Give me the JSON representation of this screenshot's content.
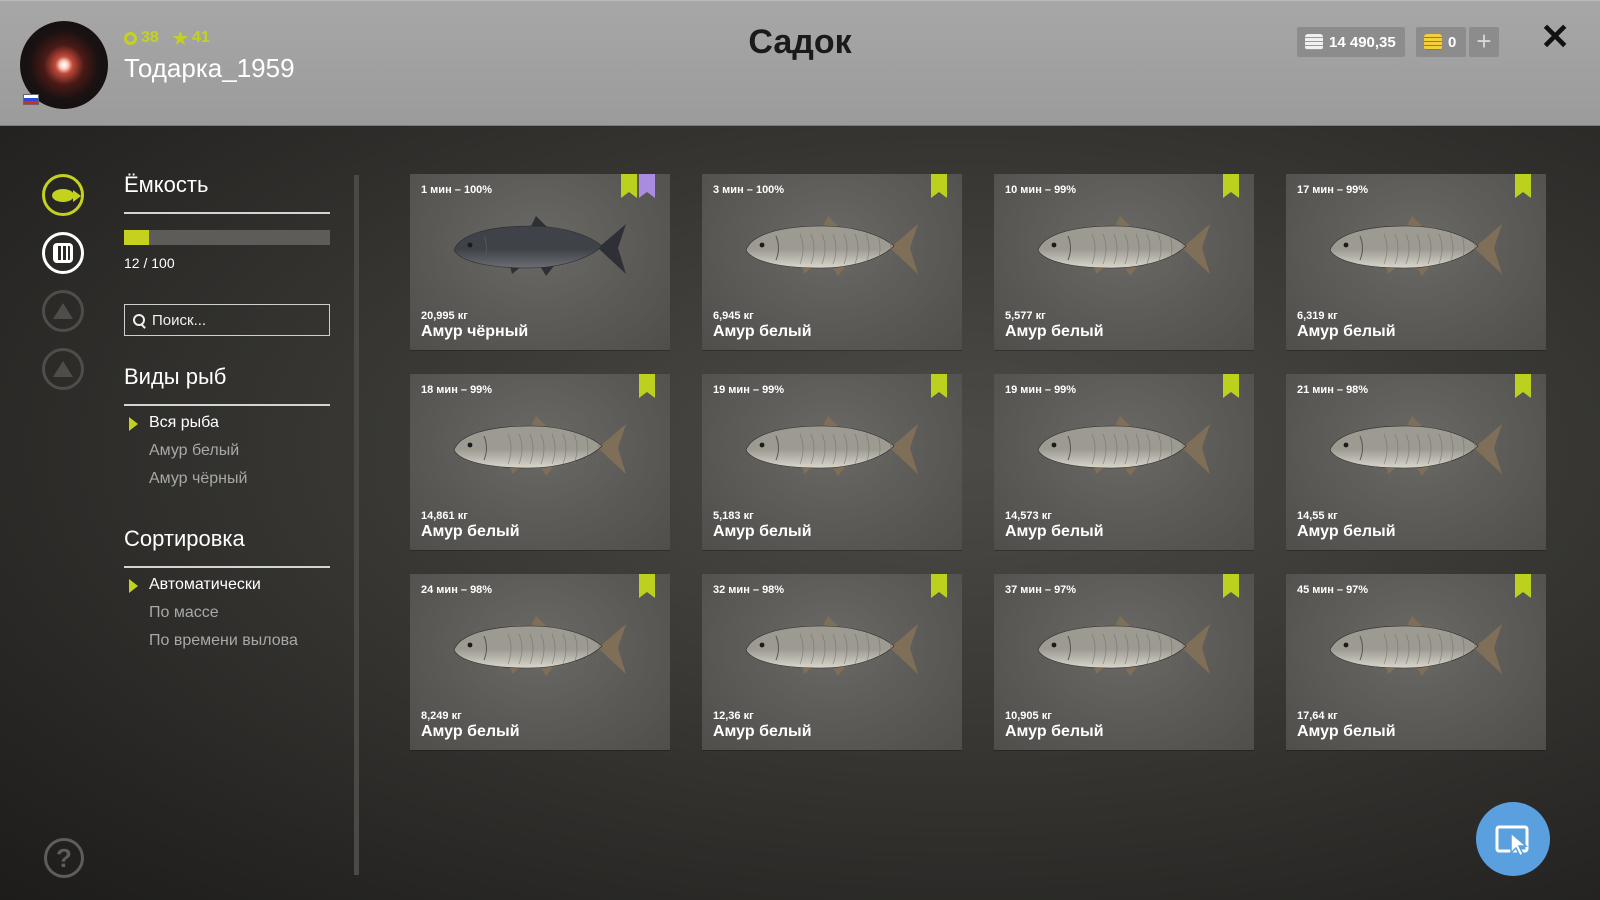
{
  "header": {
    "title": "Садок",
    "username": "Тодарка_1959",
    "level": "38",
    "rank": "41",
    "silver": "14 490,35",
    "gold": "0",
    "plus": "+",
    "close": "✕"
  },
  "panel": {
    "capacity_title": "Ёмкость",
    "capacity_text": "12 / 100",
    "capacity_fraction": 0.12,
    "search_placeholder": "Поиск...",
    "species_title": "Виды рыб",
    "species": [
      {
        "label": "Вся рыба",
        "active": true
      },
      {
        "label": "Амур белый",
        "active": false
      },
      {
        "label": "Амур чёрный",
        "active": false
      }
    ],
    "sort_title": "Сортировка",
    "sort": [
      {
        "label": "Автоматически",
        "active": true
      },
      {
        "label": "По массе",
        "active": false
      },
      {
        "label": "По времени вылова",
        "active": false
      }
    ]
  },
  "help_label": "?",
  "colors": {
    "accent": "#c4d21e",
    "purple": "#a98be0",
    "button": "#5a9fde"
  },
  "fish": [
    {
      "time": "1 мин – 100%",
      "weight": "20,995 кг",
      "name": "Амур чёрный",
      "dark": true,
      "extra_mark": true
    },
    {
      "time": "3 мин – 100%",
      "weight": "6,945 кг",
      "name": "Амур белый"
    },
    {
      "time": "10 мин – 99%",
      "weight": "5,577 кг",
      "name": "Амур белый"
    },
    {
      "time": "17 мин – 99%",
      "weight": "6,319 кг",
      "name": "Амур белый"
    },
    {
      "time": "18 мин – 99%",
      "weight": "14,861 кг",
      "name": "Амур белый"
    },
    {
      "time": "19 мин – 99%",
      "weight": "5,183 кг",
      "name": "Амур белый"
    },
    {
      "time": "19 мин – 99%",
      "weight": "14,573 кг",
      "name": "Амур белый"
    },
    {
      "time": "21 мин – 98%",
      "weight": "14,55 кг",
      "name": "Амур белый"
    },
    {
      "time": "24 мин – 98%",
      "weight": "8,249 кг",
      "name": "Амур белый"
    },
    {
      "time": "32 мин – 98%",
      "weight": "12,36 кг",
      "name": "Амур белый"
    },
    {
      "time": "37 мин – 97%",
      "weight": "10,905 кг",
      "name": "Амур белый"
    },
    {
      "time": "45 мин – 97%",
      "weight": "17,64 кг",
      "name": "Амур белый"
    }
  ]
}
